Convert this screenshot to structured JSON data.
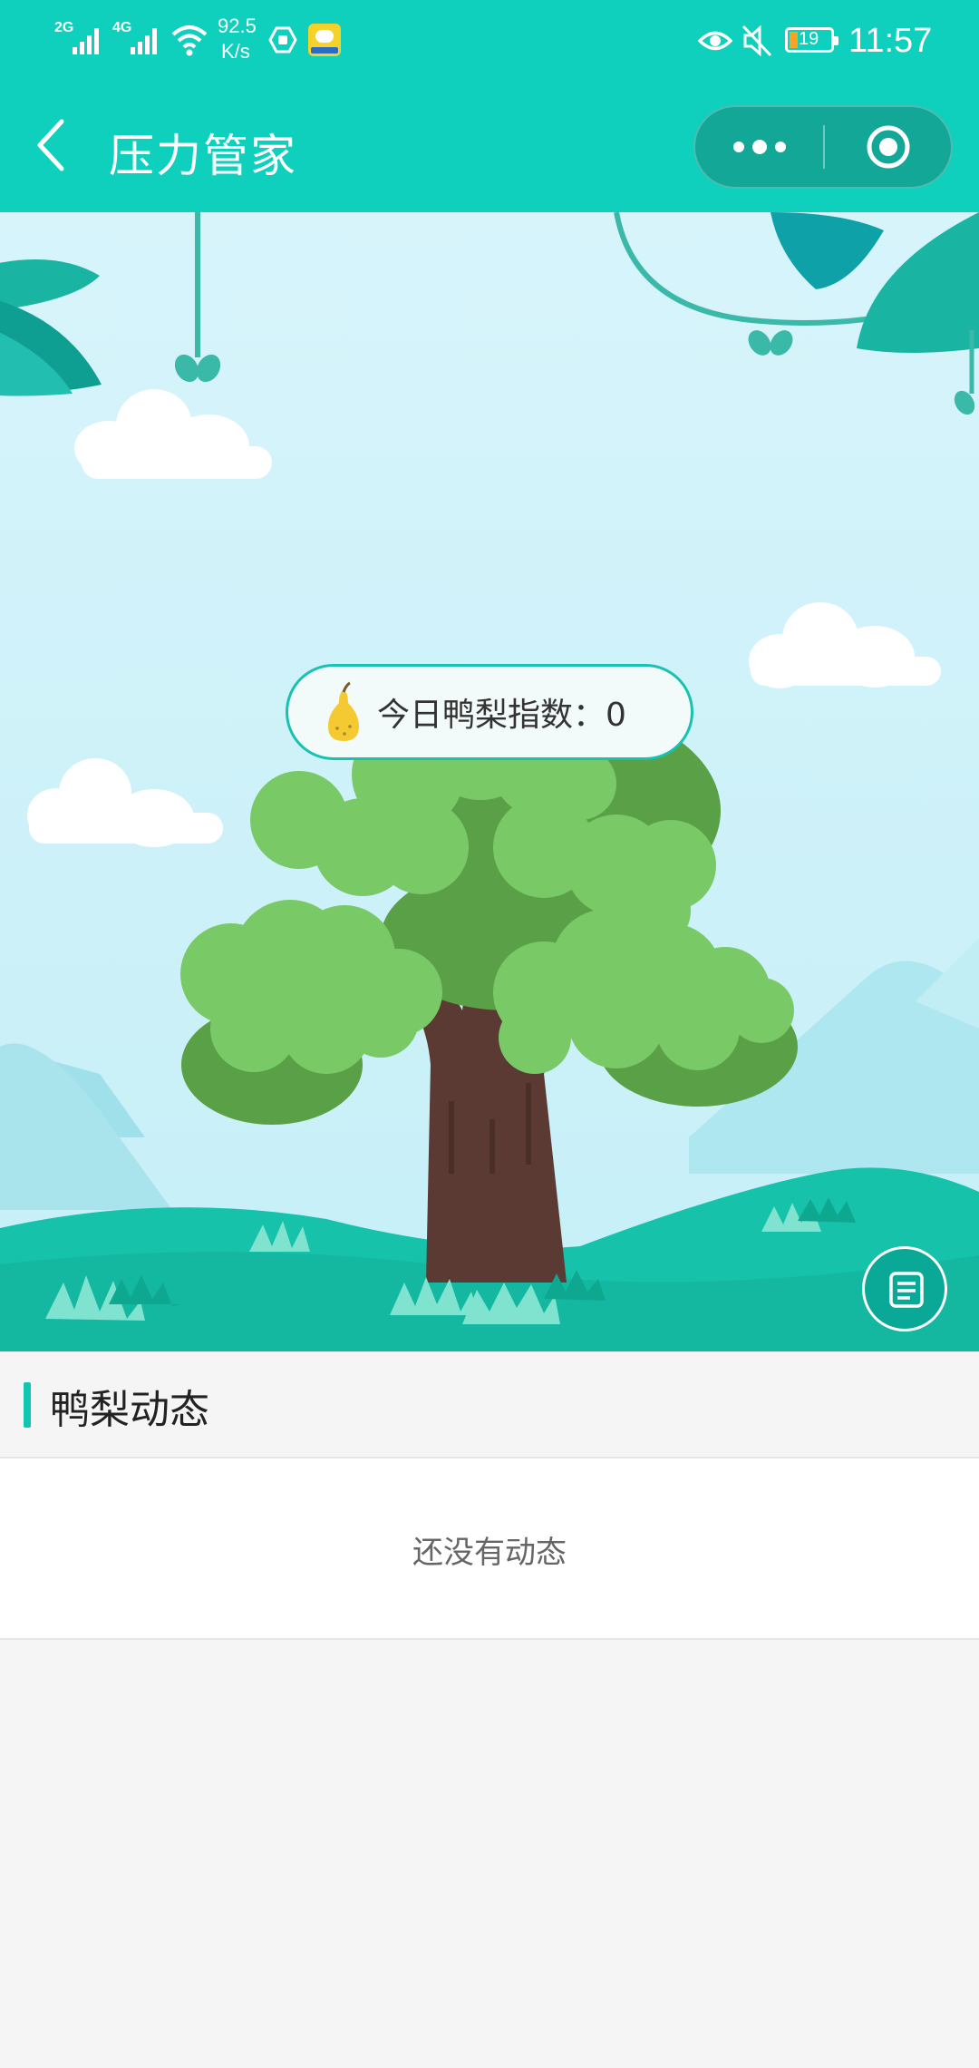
{
  "status_bar": {
    "signal_1_label": "2G",
    "signal_2_label": "4G",
    "net_speed_value": "92.5",
    "net_speed_unit": "K/s",
    "battery_level": "19",
    "time": "11:57",
    "icons": [
      "signal-2g-icon",
      "signal-4g-icon",
      "wifi-icon",
      "shield-icon",
      "app-badge-icon",
      "eye-icon",
      "mute-icon",
      "battery-icon"
    ]
  },
  "nav": {
    "title": "压力管家",
    "back_icon": "chevron-left-icon",
    "more_icon": "more-dots-icon",
    "close_icon": "target-icon"
  },
  "scene": {
    "index_label": "今日鸭梨指数：",
    "index_value": "0",
    "pear_icon": "pear-icon",
    "notes_icon": "notes-icon",
    "colors": {
      "sky": "#cdf1f8",
      "hill": "#16c2a9",
      "leaf_light": "#7ac967",
      "leaf_dark": "#5aa047",
      "trunk": "#5b3a33"
    }
  },
  "section": {
    "title": "鸭梨动态",
    "accent_color": "#11c5b3"
  },
  "feed": {
    "empty_text": "还没有动态"
  }
}
